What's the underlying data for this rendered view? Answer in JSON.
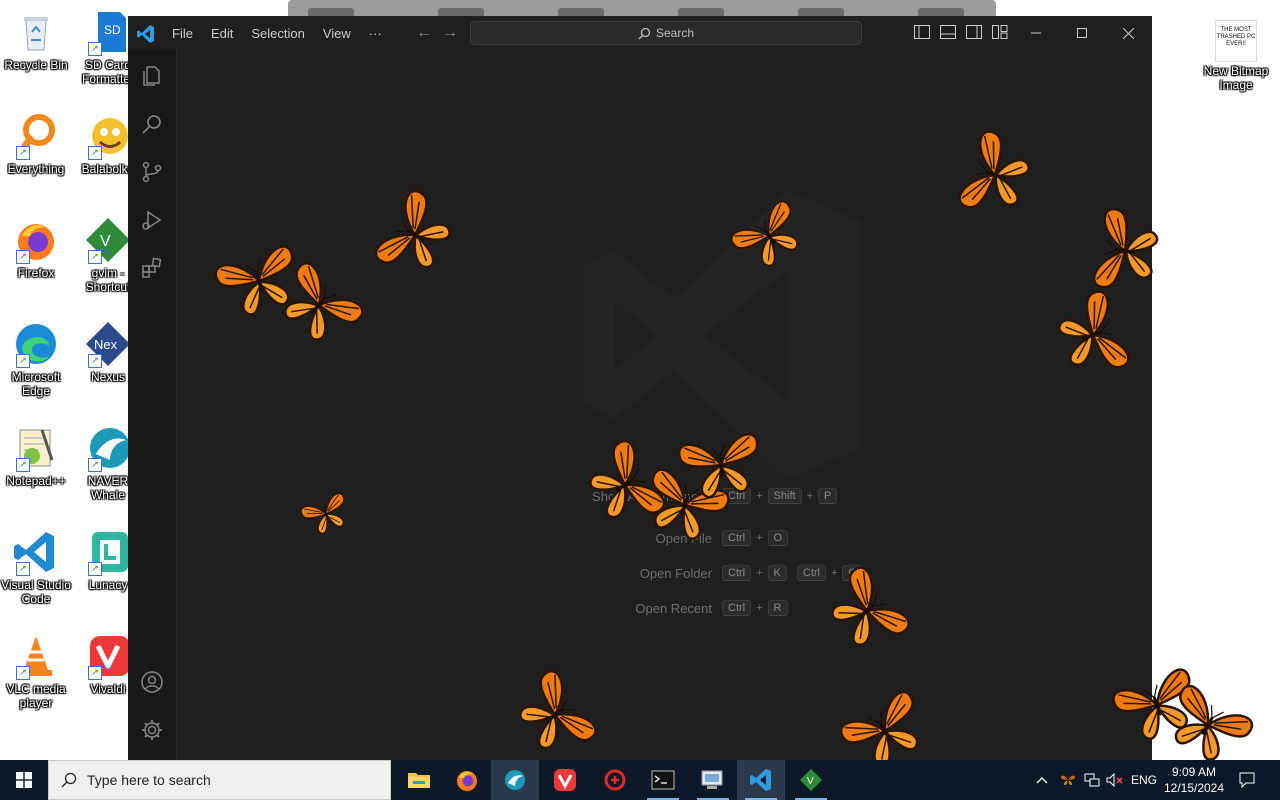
{
  "desktop": {
    "icons": [
      {
        "label": "Recycle Bin"
      },
      {
        "label": "SD Card Formatter"
      },
      {
        "label": "Everything"
      },
      {
        "label": "Balabolka"
      },
      {
        "label": "Firefox"
      },
      {
        "label": "gvim - Shortcut"
      },
      {
        "label": "Microsoft Edge"
      },
      {
        "label": "Nexus"
      },
      {
        "label": "Notepad++"
      },
      {
        "label": "NAVER Whale"
      },
      {
        "label": "Visual Studio Code"
      },
      {
        "label": "Lunacy"
      },
      {
        "label": "VLC media player"
      },
      {
        "label": "Vivaldi"
      },
      {
        "label": "New Bitmap Image",
        "thumb_text": "THE MOST TRASHED PC EVER!!"
      }
    ]
  },
  "vscode": {
    "menu": [
      "File",
      "Edit",
      "Selection",
      "View",
      "···"
    ],
    "search_label": "Search",
    "shortcuts": [
      {
        "label": "Show All Commands",
        "keys1": [
          "Ctrl",
          "Shift",
          "P"
        ],
        "keys2": []
      },
      {
        "label": "Open File",
        "keys1": [
          "Ctrl",
          "O"
        ],
        "keys2": []
      },
      {
        "label": "Open Folder",
        "keys1": [
          "Ctrl",
          "K"
        ],
        "keys2": [
          "Ctrl",
          "O"
        ]
      },
      {
        "label": "Open Recent",
        "keys1": [
          "Ctrl",
          "R"
        ],
        "keys2": []
      }
    ],
    "colors": {
      "bg": "#1f1f1f",
      "activitybar": "#181818",
      "accent": "#0078d4"
    }
  },
  "taskbar": {
    "search_placeholder": "Type here to search",
    "apps": [
      "file-explorer",
      "firefox",
      "naver-whale",
      "vivaldi",
      "app-red",
      "terminal",
      "remote-desktop",
      "vscode",
      "gvim"
    ],
    "tray_language": "ENG",
    "time": "9:09 AM",
    "date": "12/15/2024"
  }
}
